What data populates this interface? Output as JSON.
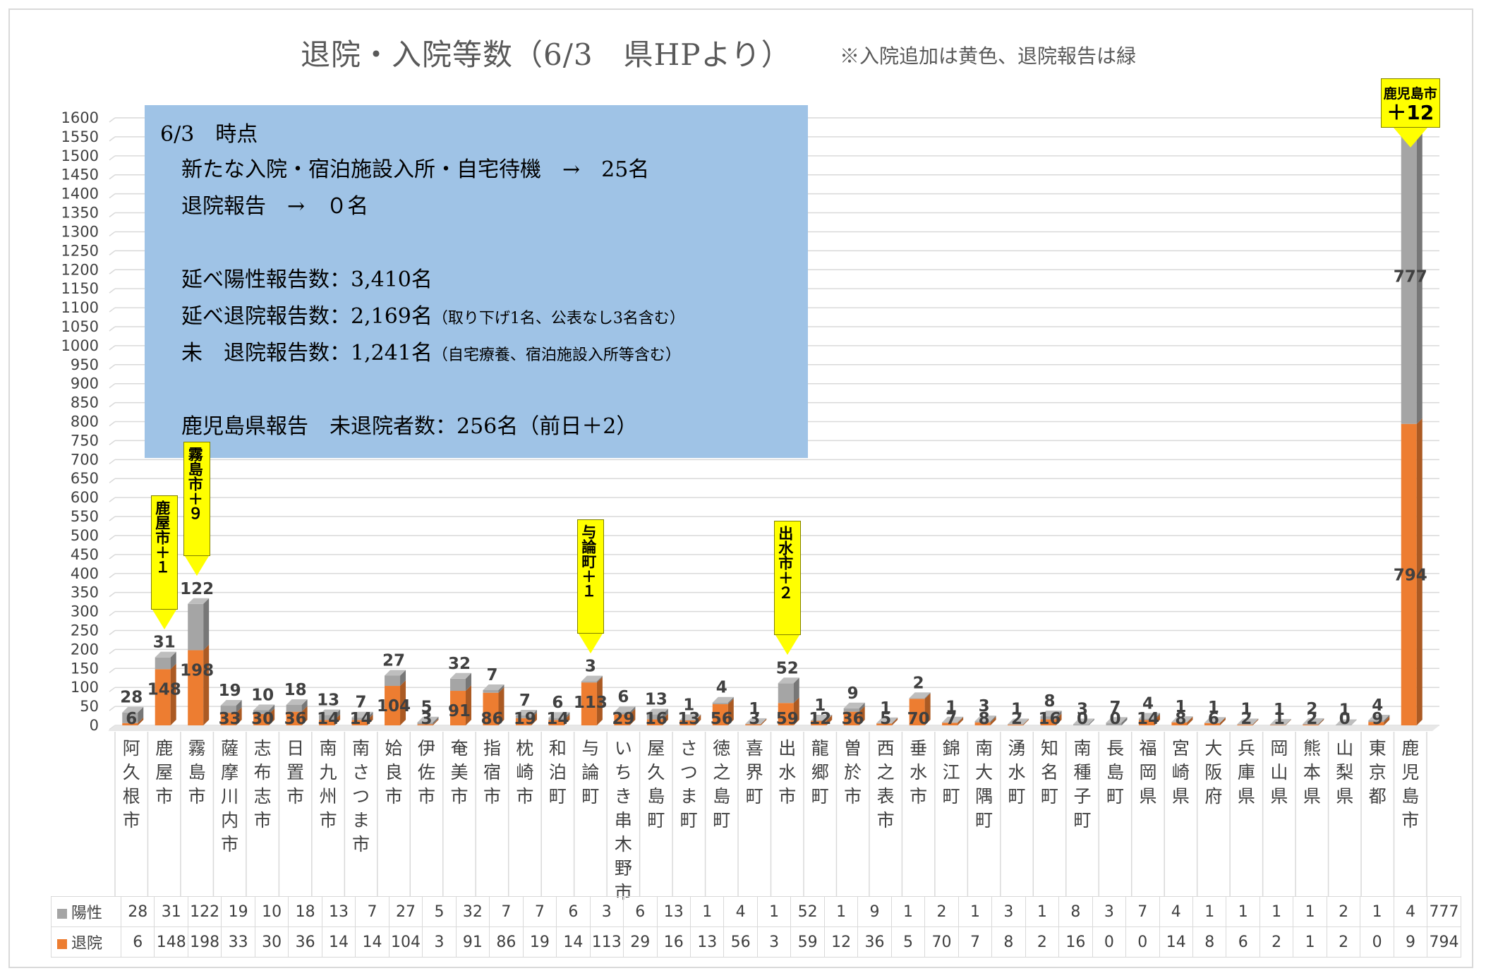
{
  "title": "退院・入院等数（6/3　県HPより）",
  "note": "※入院追加は黄色、退院報告は緑",
  "info_box": {
    "line1": "6/3　時点",
    "line2": "新たな入院・宿泊施設入所・自宅待機　→　25名",
    "line3": "退院報告　→　０名",
    "line4": "延べ陽性報告数：3,410名",
    "line5_main": "延べ退院報告数：2,169名",
    "line5_small": "（取り下げ1名、公表なし3名含む）",
    "line6_main": "未　退院報告数：1,241名",
    "line6_small": "（自宅療養、宿泊施設入所等含む）",
    "line7": "鹿児島県報告　未退院者数：256名（前日＋2）"
  },
  "callouts": [
    {
      "category": "鹿屋市",
      "text": "鹿屋市＋１"
    },
    {
      "category": "霧島市",
      "text": "霧島市＋９"
    },
    {
      "category": "与論町",
      "text": "与論町＋１"
    },
    {
      "category": "出水市",
      "text": "出水市＋２"
    },
    {
      "category": "鹿児島市",
      "line1": "鹿児島市",
      "line2": "＋12"
    }
  ],
  "colors": {
    "positive": "#a5a5a5",
    "discharged": "#ed7d31",
    "callout": "#ffff00",
    "info_box": "#9fc3e6"
  },
  "chart_data": {
    "type": "bar",
    "stacked": true,
    "categories": [
      "阿久根市",
      "鹿屋市",
      "霧島市",
      "薩摩川内市",
      "志布志市",
      "日置市",
      "南九州市",
      "南さつま市",
      "姶良市",
      "伊佐市",
      "奄美市",
      "指宿市",
      "枕崎市",
      "和泊町",
      "与論町",
      "いちき串木野市",
      "屋久島町",
      "さつま町",
      "徳之島町",
      "喜界町",
      "出水市",
      "龍郷町",
      "曽於市",
      "西之表市",
      "垂水市",
      "錦江町",
      "南大隅町",
      "湧水町",
      "知名町",
      "南種子町",
      "長島町",
      "福岡県",
      "宮崎県",
      "大阪府",
      "兵庫県",
      "岡山県",
      "熊本県",
      "山梨県",
      "東京都",
      "鹿児島市"
    ],
    "series": [
      {
        "name": "退院",
        "values": [
          6,
          148,
          198,
          33,
          30,
          36,
          14,
          14,
          104,
          3,
          91,
          86,
          19,
          14,
          113,
          29,
          16,
          13,
          56,
          3,
          59,
          12,
          36,
          5,
          70,
          7,
          8,
          2,
          16,
          0,
          0,
          14,
          8,
          6,
          2,
          1,
          2,
          0,
          9,
          794
        ]
      },
      {
        "name": "陽性",
        "values": [
          28,
          31,
          122,
          19,
          10,
          18,
          13,
          7,
          27,
          5,
          32,
          7,
          7,
          6,
          3,
          6,
          13,
          1,
          4,
          1,
          52,
          1,
          9,
          1,
          2,
          1,
          3,
          1,
          8,
          3,
          7,
          4,
          1,
          1,
          1,
          1,
          2,
          1,
          4,
          777
        ]
      }
    ],
    "ylim": [
      0,
      1600
    ],
    "yticks": [
      0,
      50,
      100,
      150,
      200,
      250,
      300,
      350,
      400,
      450,
      500,
      550,
      600,
      650,
      700,
      750,
      800,
      850,
      900,
      950,
      1000,
      1050,
      1100,
      1150,
      1200,
      1250,
      1300,
      1350,
      1400,
      1450,
      1500,
      1550,
      1600
    ],
    "grid": true,
    "legend": "data table below chart",
    "title": "退院・入院等数（6/3　県HPより）"
  }
}
